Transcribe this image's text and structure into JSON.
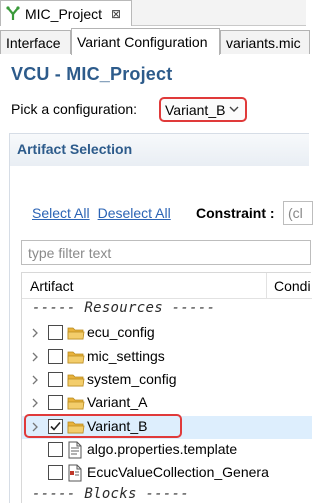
{
  "editor_tab": {
    "title": "MIC_Project",
    "close_glyph": "⊠"
  },
  "subtabs": [
    "Interface",
    "Variant Configuration",
    "variants.mic"
  ],
  "editor_title": "VCU - MIC_Project",
  "configuration": {
    "label": "Pick a configuration:",
    "selected": "Variant_B"
  },
  "section": {
    "title": "Artifact Selection",
    "select_all": "Select All",
    "deselect_all": "Deselect All",
    "constraint_label": "Constraint :",
    "constraint_value": "(cl",
    "filter_placeholder": "type filter text"
  },
  "table": {
    "columns": [
      "Artifact",
      "Condi"
    ],
    "rows": [
      {
        "type": "separator",
        "label": "----- Resources -----"
      },
      {
        "type": "folder",
        "label": "ecu_config",
        "checked": false,
        "expandable": true
      },
      {
        "type": "folder",
        "label": "mic_settings",
        "checked": false,
        "expandable": true
      },
      {
        "type": "folder",
        "label": "system_config",
        "checked": false,
        "expandable": true
      },
      {
        "type": "folder",
        "label": "Variant_A",
        "checked": false,
        "expandable": true
      },
      {
        "type": "folder",
        "label": "Variant_B",
        "checked": true,
        "expandable": true
      },
      {
        "type": "file",
        "label": "algo.properties.template",
        "checked": false,
        "icon": "text-file-icon"
      },
      {
        "type": "file",
        "label": "EcucValueCollection_Genera",
        "checked": false,
        "icon": "ecuc-file-icon"
      },
      {
        "type": "separator",
        "label": "----- Blocks -----"
      }
    ]
  },
  "colors": {
    "title": "#2d5b8b",
    "link": "#2c64b5",
    "highlight": "#e03a3a",
    "folder": "#e8b23c"
  }
}
